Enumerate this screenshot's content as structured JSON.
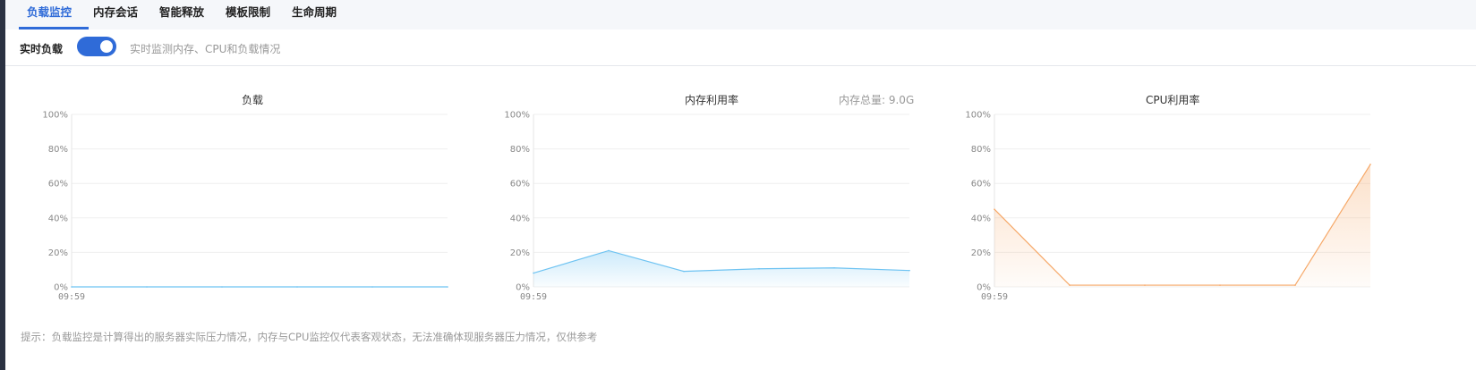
{
  "tabs": [
    {
      "label": "负载监控",
      "active": true
    },
    {
      "label": "内存会话",
      "active": false
    },
    {
      "label": "智能释放",
      "active": false
    },
    {
      "label": "模板限制",
      "active": false
    },
    {
      "label": "生命周期",
      "active": false
    }
  ],
  "realtime": {
    "label": "实时负载",
    "enabled": true,
    "description": "实时监测内存、CPU和负载情况"
  },
  "memory_total": "内存总量: 9.0G",
  "colors": {
    "accent": "#2f6bd8",
    "load_line": "#6ec3f2",
    "memory_line": "#6ec3f2",
    "cpu_line": "#f6a868"
  },
  "chart_data": [
    {
      "type": "line",
      "title": "负载",
      "xlabel": "",
      "ylabel": "",
      "x": [
        "09:59",
        "",
        "",
        "",
        "",
        ""
      ],
      "y_ticks": [
        "100%",
        "80%",
        "60%",
        "40%",
        "20%",
        "0%"
      ],
      "ylim": [
        0,
        100
      ],
      "grid": true,
      "area": false,
      "series": [
        {
          "values": [
            0,
            0,
            0,
            0,
            0,
            0
          ]
        }
      ]
    },
    {
      "type": "area",
      "title": "内存利用率",
      "xlabel": "",
      "ylabel": "",
      "x": [
        "09:59",
        "",
        "",
        "",
        "",
        ""
      ],
      "y_ticks": [
        "100%",
        "80%",
        "60%",
        "40%",
        "20%",
        "0%"
      ],
      "ylim": [
        0,
        100
      ],
      "grid": true,
      "area": true,
      "series": [
        {
          "values": [
            8,
            21,
            9,
            10.5,
            11,
            9.5
          ]
        }
      ]
    },
    {
      "type": "area",
      "title": "CPU利用率",
      "xlabel": "",
      "ylabel": "",
      "x": [
        "09:59",
        "",
        "",
        "",
        "",
        ""
      ],
      "y_ticks": [
        "100%",
        "80%",
        "60%",
        "40%",
        "20%",
        "0%"
      ],
      "ylim": [
        0,
        100
      ],
      "grid": true,
      "area": true,
      "series": [
        {
          "values": [
            45,
            1,
            1,
            1,
            1,
            71
          ]
        }
      ]
    }
  ],
  "footer": {
    "note": "提示：负载监控是计算得出的服务器实际压力情况，内存与CPU监控仅代表客观状态，无法准确体现服务器压力情况，仅供参考"
  }
}
